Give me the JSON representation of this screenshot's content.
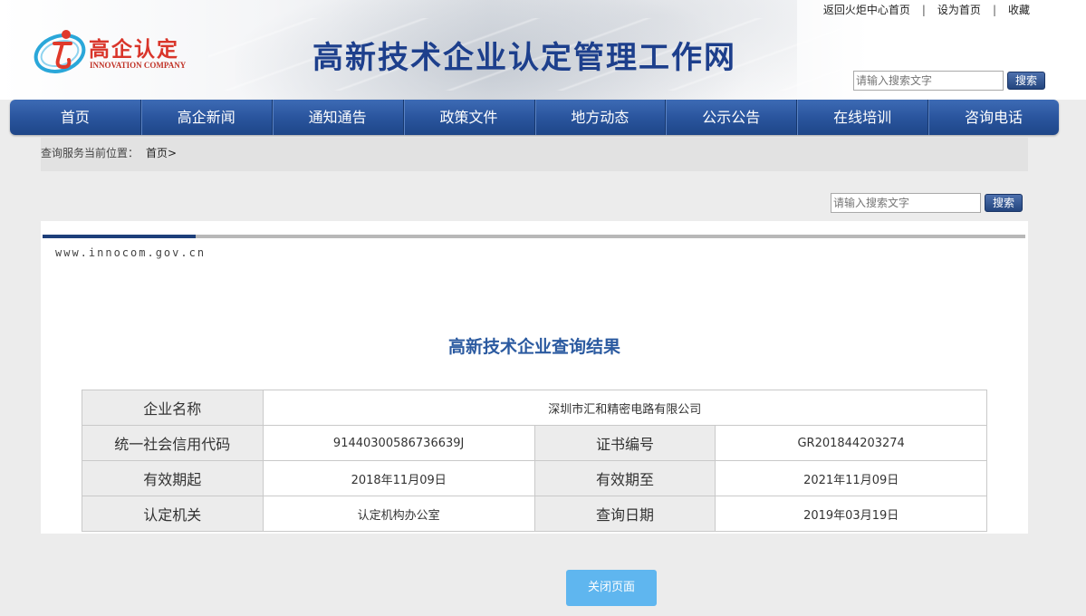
{
  "toplinks": {
    "back_home": "返回火炬中心首页",
    "set_home": "设为首页",
    "favorite": "收藏",
    "separator": "|"
  },
  "logo": {
    "cn": "高企认定",
    "en": "INNOVATION COMPANY",
    "icon": "logo-mark-icon"
  },
  "site_title": "高新技术企业认定管理工作网",
  "header_search": {
    "placeholder": "请输入搜索文字",
    "button": "搜索"
  },
  "nav": {
    "items": [
      "首页",
      "高企新闻",
      "通知通告",
      "政策文件",
      "地方动态",
      "公示公告",
      "在线培训",
      "咨询电话"
    ]
  },
  "breadcrumb": {
    "label": "查询服务当前位置：",
    "home": "首页>"
  },
  "main_search": {
    "placeholder": "请输入搜索文字",
    "button": "搜索"
  },
  "panel": {
    "domain": "www.innocom.gov.cn",
    "title": "高新技术企业查询结果"
  },
  "result": {
    "company_name_label": "企业名称",
    "company_name": "深圳市汇和精密电路有限公司",
    "credit_code_label": "统一社会信用代码",
    "credit_code": "91440300586736639J",
    "cert_no_label": "证书编号",
    "cert_no": "GR201844203274",
    "valid_from_label": "有效期起",
    "valid_from": "2018年11月09日",
    "valid_to_label": "有效期至",
    "valid_to": "2021年11月09日",
    "authority_label": "认定机关",
    "authority": "认定机构办公室",
    "query_date_label": "查询日期",
    "query_date": "2019年03月19日"
  },
  "close_button": "关闭页面",
  "colors": {
    "nav": "#2a559e",
    "title_blue": "#1d3f8c",
    "logo_red": "#d9352a",
    "close_button": "#5fb6ef"
  }
}
